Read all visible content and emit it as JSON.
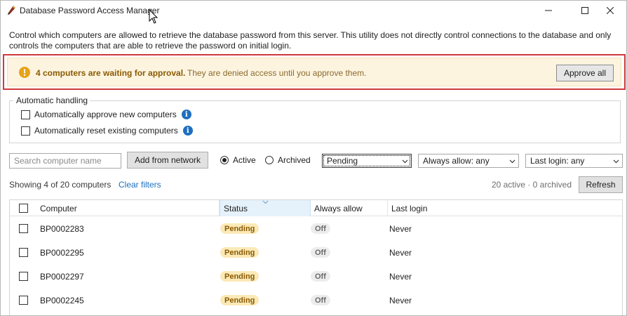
{
  "window": {
    "title": "Database Password Access Manager",
    "icon": "pen-icon"
  },
  "description": "Control which computers are allowed to retrieve the database password from this server. This utility does not directly control connections to the database and only controls the computers that are able to retrieve the password on initial login.",
  "banner": {
    "strong": "4 computers are waiting for approval.",
    "text": "They are denied access until you approve them.",
    "approve_all_label": "Approve all",
    "color": "#fdf4e0",
    "outline_color": "#d0383c"
  },
  "automatic": {
    "legend": "Automatic handling",
    "options": [
      {
        "label": "Automatically approve new computers",
        "checked": false
      },
      {
        "label": "Automatically reset existing computers",
        "checked": false
      }
    ]
  },
  "toolbar": {
    "search_placeholder": "Search computer name",
    "add_label": "Add from network",
    "radio_active": "Active",
    "radio_archived": "Archived",
    "selected_radio": "Active",
    "status_filter": "Pending",
    "allow_filter": "Always allow: any",
    "login_filter": "Last login: any"
  },
  "summary": {
    "showing": "Showing 4 of 20 computers",
    "clear_filters": "Clear filters",
    "counts": "20 active · 0 archived",
    "refresh_label": "Refresh"
  },
  "table": {
    "headers": {
      "computer": "Computer",
      "status": "Status",
      "always_allow": "Always allow",
      "last_login": "Last login"
    },
    "sorted_column": "Status",
    "rows": [
      {
        "computer": "BP0002283",
        "status": "Pending",
        "always_allow": "Off",
        "last_login": "Never"
      },
      {
        "computer": "BP0002295",
        "status": "Pending",
        "always_allow": "Off",
        "last_login": "Never"
      },
      {
        "computer": "BP0002297",
        "status": "Pending",
        "always_allow": "Off",
        "last_login": "Never"
      },
      {
        "computer": "BP0002245",
        "status": "Pending",
        "always_allow": "Off",
        "last_login": "Never"
      }
    ]
  },
  "colors": {
    "link": "#1a6fc0",
    "pending_pill": "#fbe9b7",
    "off_pill": "#ececec",
    "info_icon": "#1f6fbf"
  }
}
